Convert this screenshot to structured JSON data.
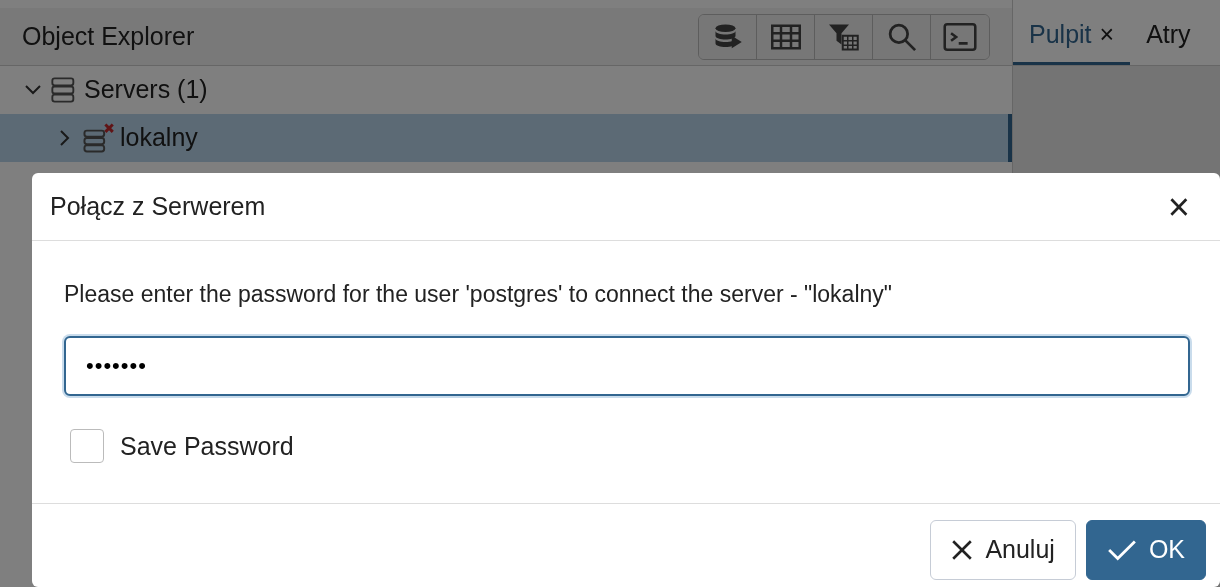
{
  "explorer": {
    "title": "Object Explorer",
    "toolbar": [
      {
        "kind": "database"
      },
      {
        "kind": "table"
      },
      {
        "kind": "filter"
      },
      {
        "kind": "search"
      },
      {
        "kind": "terminal"
      }
    ],
    "tree": [
      {
        "label": "Servers",
        "count": "(1)",
        "expanded": true,
        "selected": false,
        "children": [
          {
            "label": "lokalny",
            "expanded": false,
            "selected": true
          }
        ]
      }
    ]
  },
  "tabs": [
    {
      "label": "Pulpit",
      "close": "×",
      "selected": true
    },
    {
      "label": "Atry",
      "selected": false
    }
  ],
  "dialog": {
    "title": "Połącz z Serwerem",
    "close": "×",
    "message": "Please enter the password for the user 'postgres' to connect the server - \"lokalny\"",
    "password": {
      "value": "•••••••"
    },
    "save_password": {
      "label": "Save Password",
      "checked": false
    },
    "buttons": [
      {
        "kind": "cancel",
        "label": "Anuluj"
      },
      {
        "kind": "ok",
        "label": "OK"
      }
    ]
  }
}
